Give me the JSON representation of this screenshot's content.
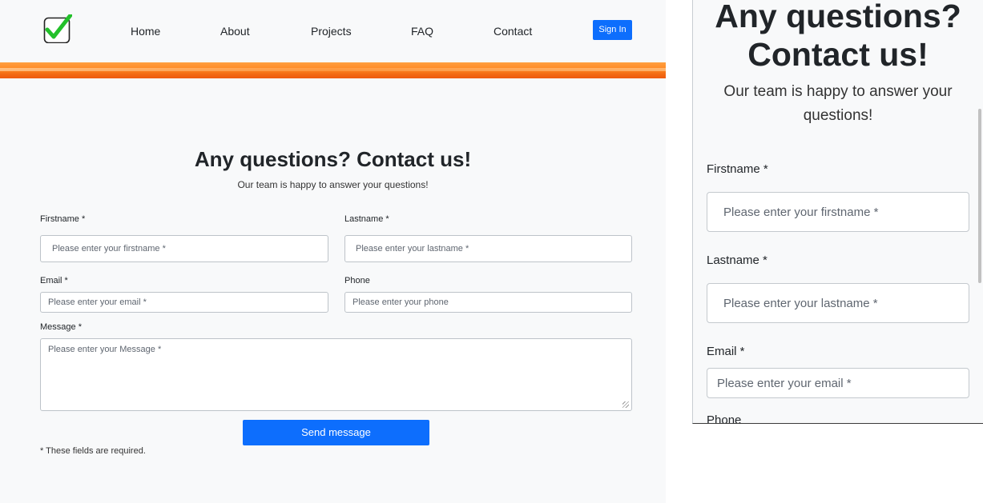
{
  "nav": {
    "logo": "checkmark-logo",
    "links": [
      "Home",
      "About",
      "Projects",
      "FAQ",
      "Contact"
    ],
    "signin": "Sign In"
  },
  "contact": {
    "title": "Any questions? Contact us!",
    "title_line1": "Any questions?",
    "title_line2": "Contact us!",
    "subtitle": "Our team is happy to answer your questions!",
    "subtitle_line1": "Our team is happy to answer your",
    "subtitle_line2": "questions!",
    "fields": {
      "firstname": {
        "label": "Firstname *",
        "placeholder": "Please enter your firstname *"
      },
      "lastname": {
        "label": "Lastname *",
        "placeholder": "Please enter your lastname *"
      },
      "email": {
        "label": "Email *",
        "placeholder": "Please enter your email *"
      },
      "phone": {
        "label": "Phone",
        "placeholder": "Please enter your phone"
      },
      "message": {
        "label": "Message *",
        "placeholder": "Please enter your Message *"
      }
    },
    "send": "Send message",
    "footnote": "* These fields are required."
  },
  "colors": {
    "primary": "#0d6efd",
    "banner": "#f26a12",
    "background": "#f8f9fa",
    "check": "#22c02a"
  }
}
